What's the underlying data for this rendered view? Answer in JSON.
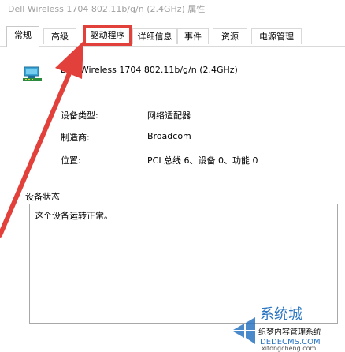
{
  "window": {
    "title": "Dell Wireless 1704 802.11b/g/n (2.4GHz) 属性"
  },
  "tabs": [
    {
      "label": "常规",
      "active": true
    },
    {
      "label": "高级",
      "active": false
    },
    {
      "label": "驱动程序",
      "active": false,
      "highlighted": true
    },
    {
      "label": "详细信息",
      "active": false
    },
    {
      "label": "事件",
      "active": false
    },
    {
      "label": "资源",
      "active": false
    },
    {
      "label": "电源管理",
      "active": false
    }
  ],
  "device": {
    "name": "Dell Wireless 1704 802.11b/g/n (2.4GHz)",
    "icon": "network-adapter-icon"
  },
  "properties": {
    "type_label": "设备类型:",
    "type_value": "网络适配器",
    "manufacturer_label": "制造商:",
    "manufacturer_value": "Broadcom",
    "location_label": "位置:",
    "location_value": "PCI 总线 6、设备 0、功能 0"
  },
  "status": {
    "group_label": "设备状态",
    "text": "这个设备运转正常。"
  },
  "watermark": {
    "brand": "系统城",
    "line1": "织梦内容管理系统",
    "line2": "DEDECMS.COM",
    "url": "xitongcheng.com"
  },
  "colors": {
    "highlight": "#e2403a",
    "watermark_blue": "#2b76c2"
  }
}
